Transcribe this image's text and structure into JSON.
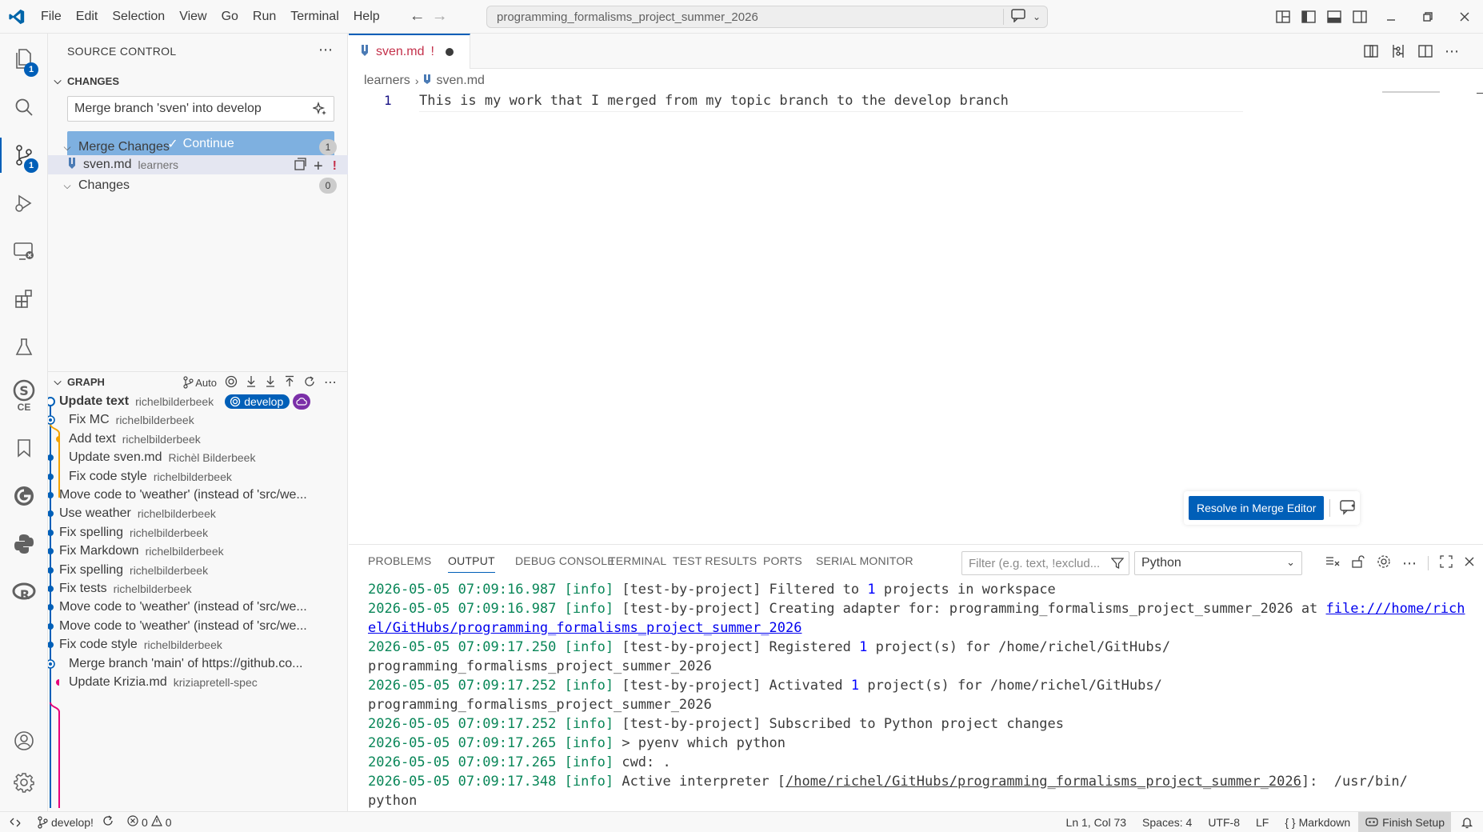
{
  "menu": [
    "File",
    "Edit",
    "Selection",
    "View",
    "Go",
    "Run",
    "Terminal",
    "Help"
  ],
  "command_center": {
    "text": "programming_formalisms_project_summer_2026"
  },
  "activity": {
    "explorer_badge": "1",
    "scm_badge": "1",
    "sonar_label": "CE"
  },
  "sidebar": {
    "title": "SOURCE CONTROL",
    "changes_header": "CHANGES",
    "commit_message": "Merge branch 'sven' into develop",
    "continue_label": "Continue",
    "merge_changes": {
      "label": "Merge Changes",
      "count": "1"
    },
    "file": {
      "name": "sven.md",
      "dir": "learners",
      "status": "!"
    },
    "changes": {
      "label": "Changes",
      "count": "0"
    }
  },
  "graph": {
    "header": "GRAPH",
    "auto_label": "Auto",
    "branch_tag": "develop",
    "commits": [
      {
        "message": "Update text",
        "author": "richelbilderbeek"
      },
      {
        "message": "Fix MC",
        "author": "richelbilderbeek"
      },
      {
        "message": "Add text",
        "author": "richelbilderbeek"
      },
      {
        "message": "Update sven.md",
        "author": "Richèl Bilderbeek"
      },
      {
        "message": "Fix code style",
        "author": "richelbilderbeek"
      },
      {
        "message": "Move code to 'weather' (instead of 'src/we...",
        "author": ""
      },
      {
        "message": "Use weather",
        "author": "richelbilderbeek"
      },
      {
        "message": "Fix spelling",
        "author": "richelbilderbeek"
      },
      {
        "message": "Fix Markdown",
        "author": "richelbilderbeek"
      },
      {
        "message": "Fix spelling",
        "author": "richelbilderbeek"
      },
      {
        "message": "Fix tests",
        "author": "richelbilderbeek"
      },
      {
        "message": "Move code to 'weather' (instead of 'src/we...",
        "author": ""
      },
      {
        "message": "Move code to 'weather' (instead of 'src/we...",
        "author": ""
      },
      {
        "message": "Fix code style",
        "author": "richelbilderbeek"
      },
      {
        "message": "Merge branch 'main' of https://github.co...",
        "author": ""
      },
      {
        "message": "Update Krizia.md",
        "author": "kriziapretell-spec"
      }
    ]
  },
  "editor": {
    "tab_name": "sven.md",
    "tab_status": "!",
    "breadcrumb": [
      "learners",
      "sven.md"
    ],
    "line_number": "1",
    "line_text": "This is my work that I merged from my topic branch to the develop branch",
    "resolve_label": "Resolve in Merge Editor"
  },
  "panel": {
    "tabs": [
      "PROBLEMS",
      "OUTPUT",
      "DEBUG CONSOLE",
      "TERMINAL",
      "TEST RESULTS",
      "PORTS",
      "SERIAL MONITOR"
    ],
    "filter_placeholder": "Filter (e.g. text, !exclud...",
    "channel": "Python",
    "lines": [
      {
        "ts": "2026-05-05 07:09:16.987",
        "lvl": "[info]",
        "pre": "[test-by-project] Filtered to ",
        "num": "1",
        "post": " projects in workspace"
      },
      {
        "ts": "2026-05-05 07:09:16.987",
        "lvl": "[info]",
        "pre": "[test-by-project] Creating adapter for: programming_formalisms_project_summer_2026 at ",
        "link": "file:///home/richel/GitHubs/programming_formalisms_project_summer_2026"
      },
      {
        "ts": "2026-05-05 07:09:17.250",
        "lvl": "[info]",
        "pre": "[test-by-project] Registered ",
        "num": "1",
        "post": " project(s) for /home/richel/GitHubs/\nprogramming_formalisms_project_summer_2026"
      },
      {
        "ts": "2026-05-05 07:09:17.252",
        "lvl": "[info]",
        "pre": "[test-by-project] Activated ",
        "num": "1",
        "post": " project(s) for /home/richel/GitHubs/\nprogramming_formalisms_project_summer_2026"
      },
      {
        "ts": "2026-05-05 07:09:17.252",
        "lvl": "[info]",
        "pre": "[test-by-project] Subscribed to Python project changes"
      },
      {
        "ts": "2026-05-05 07:09:17.265",
        "lvl": "[info]",
        "pre": "> pyenv which python"
      },
      {
        "ts": "2026-05-05 07:09:17.265",
        "lvl": "[info]",
        "pre": "cwd: ."
      },
      {
        "ts": "2026-05-05 07:09:17.348",
        "lvl": "[info]",
        "pre": "Active interpreter [",
        "link2": "/home/richel/GitHubs/programming_formalisms_project_summer_2026",
        "post": "]:  /usr/bin/\npython"
      }
    ]
  },
  "status": {
    "branch": "develop!",
    "errors": "0",
    "warnings": "0",
    "position": "Ln 1, Col 73",
    "spaces": "Spaces: 4",
    "encoding": "UTF-8",
    "eol": "LF",
    "language": "Markdown",
    "finish_setup": "Finish Setup"
  },
  "colors": {
    "accent": "#005fb8",
    "conflict": "#c4314b"
  }
}
